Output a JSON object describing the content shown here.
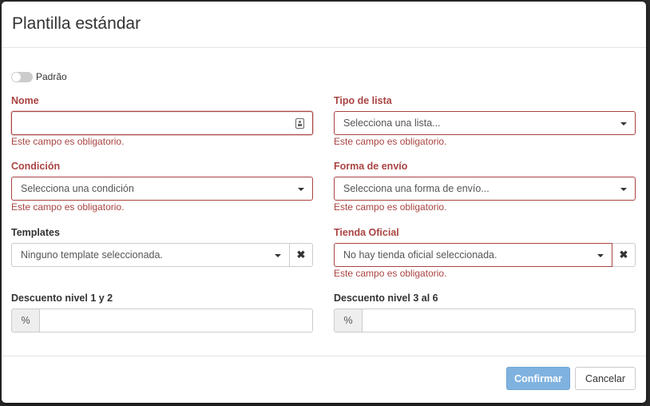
{
  "modal": {
    "title": "Plantilla estándar"
  },
  "toggle": {
    "label": "Padrão",
    "on": false
  },
  "fields": {
    "nome": {
      "label": "Nome",
      "value": "",
      "error": "Este campo es obligatorio."
    },
    "tipo_lista": {
      "label": "Tipo de lista",
      "placeholder": "Selecciona una lista...",
      "error": "Este campo es obligatorio."
    },
    "condicion": {
      "label": "Condición",
      "placeholder": "Selecciona una condición",
      "error": "Este campo es obligatorio."
    },
    "forma_envio": {
      "label": "Forma de envío",
      "placeholder": "Selecciona una forma de envío...",
      "error": "Este campo es obligatorio."
    },
    "templates": {
      "label": "Templates",
      "placeholder": "Ninguno template seleccionada.",
      "clear": "✖"
    },
    "tienda_oficial": {
      "label": "Tienda Oficial",
      "placeholder": "No hay tienda oficial seleccionada.",
      "clear": "✖",
      "error": "Este campo es obligatorio."
    },
    "descuento_1_2": {
      "label": "Descuento nivel 1 y 2",
      "addon": "%",
      "value": ""
    },
    "descuento_3_6": {
      "label": "Descuento nivel 3 al 6",
      "addon": "%",
      "value": ""
    }
  },
  "footer": {
    "confirm_label": "Confirmar",
    "cancel_label": "Cancelar"
  },
  "colors": {
    "error": "#a94442",
    "primary_disabled": "#7fb2df"
  },
  "icons": {
    "contact": "contact-card-icon",
    "caret": "caret-down-icon",
    "clear": "close-icon"
  }
}
